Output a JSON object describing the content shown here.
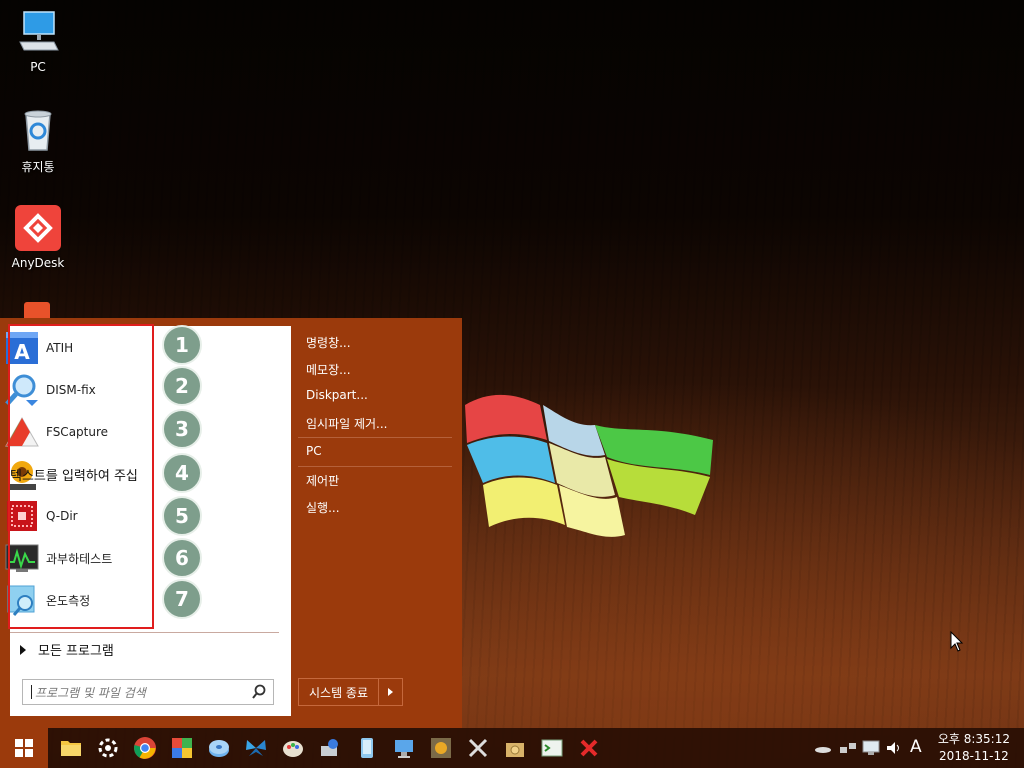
{
  "desktop": {
    "icons": [
      {
        "label": "PC",
        "icon": "monitor-icon"
      },
      {
        "label": "휴지통",
        "icon": "recycle-bin-icon"
      },
      {
        "label": "AnyDesk",
        "icon": "anydesk-icon"
      }
    ]
  },
  "start_menu": {
    "programs": [
      {
        "label": "ATIH",
        "icon": "acronis-icon",
        "number": "1"
      },
      {
        "label": "DISM-fix",
        "icon": "magnifier-icon",
        "number": "2"
      },
      {
        "label": "FSCapture",
        "icon": "fscapture-icon",
        "number": "3"
      },
      {
        "label": "",
        "icon": "imageglass-icon",
        "number": "4"
      },
      {
        "label": "Q-Dir",
        "icon": "qdir-icon",
        "number": "5"
      },
      {
        "label": "과부하테스트",
        "icon": "stress-test-icon",
        "number": "6"
      },
      {
        "label": "온도측정",
        "icon": "temperature-icon",
        "number": "7"
      }
    ],
    "overlap_text": "텍스트를 입력하여 주십",
    "all_programs": "모든 프로그램",
    "search_placeholder": "프로그램 및 파일 검색",
    "right_links": [
      "명령창...",
      "메모장...",
      "Diskpart...",
      "임시파일 제거...",
      "PC",
      "제어판",
      "실행..."
    ],
    "shutdown_label": "시스템 종료",
    "colors": {
      "menu_bg": "#9b3a0c",
      "highlight_border": "#e01d1d",
      "number_circle": "#7e9e8c"
    }
  },
  "taskbar": {
    "pinned": [
      "folder-icon",
      "settings-icon",
      "chrome-icon",
      "puzzle-icon",
      "disk-icon",
      "butterfly-icon",
      "paint-icon",
      "network-tool-icon",
      "mobile-icon",
      "computer-icon",
      "imageglass-icon",
      "tools-icon",
      "archive-icon",
      "terminal-icon",
      "close-x-icon"
    ],
    "tray": [
      "cloud-icon",
      "network-icon",
      "monitor-tray-icon",
      "volume-icon"
    ],
    "ime": "A",
    "clock_time": "오후 8:35:12",
    "clock_date": "2018-11-12"
  }
}
